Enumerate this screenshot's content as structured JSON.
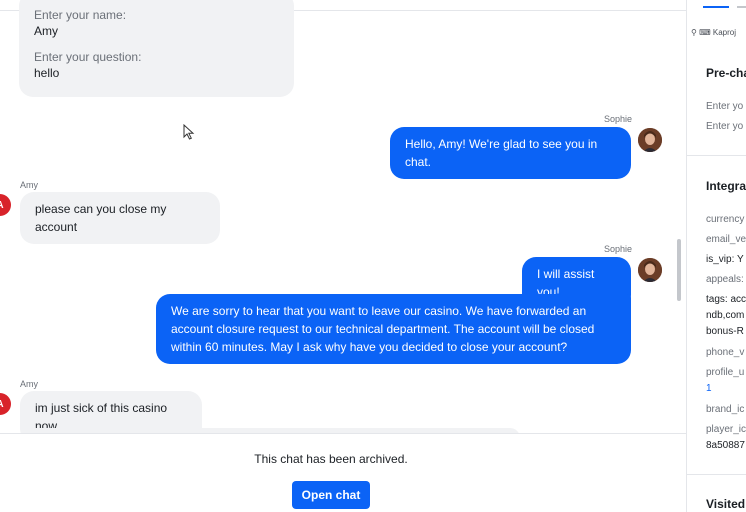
{
  "prechat_form": {
    "name_label": "Enter your name:",
    "name_value": "Amy",
    "question_label": "Enter your question:",
    "question_value": "hello"
  },
  "messages": [
    {
      "sender": "Sophie",
      "text": "Hello, Amy! We're glad to see you in chat."
    },
    {
      "sender": "Amy",
      "avatar_letter": "A",
      "text": "please can you close my account"
    },
    {
      "sender": "Sophie",
      "text": "I will assist you!"
    },
    {
      "text": "We are sorry to hear that you want to leave our casino. We have forwarded an account closure request to our technical department. The account will be closed within 60 minutes. May I ask why have you decided to close your account?"
    },
    {
      "sender": "Amy",
      "avatar_letter": "A",
      "text": "im just sick of this casino now"
    }
  ],
  "footer": {
    "archived_text": "This chat has been archived.",
    "open_chat_label": "Open chat"
  },
  "panel": {
    "keyboard_label": "Kaproj",
    "prechat_title": "Pre-cha",
    "prechat_rows": [
      "Enter yo",
      "Enter yo"
    ],
    "integration_title": "Integra",
    "integration_rows": [
      "currency",
      "email_ve",
      "is_vip: Y",
      "appeals:",
      "tags: acc",
      "ndb,com",
      "bonus-R",
      "phone_v",
      "profile_u",
      "1",
      "brand_ic",
      "player_ic",
      "8a50887"
    ],
    "visited_title": "Visited"
  },
  "colors": {
    "accent": "#0b63f6",
    "visitor_bubble": "#f1f2f4",
    "visitor_avatar": "#d8232a"
  }
}
